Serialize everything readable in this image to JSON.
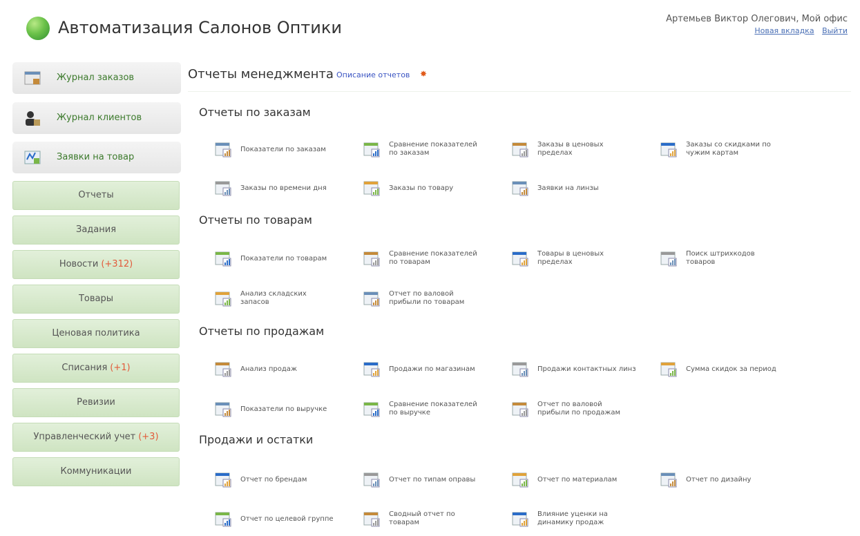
{
  "header": {
    "app_title": "Автоматизация Салонов Оптики",
    "user_name": "Артемьев Виктор Олегович, Мой офис",
    "new_tab": "Новая вкладка",
    "logout": "Выйти"
  },
  "sidebar": {
    "top_items": [
      {
        "label": "Журнал заказов",
        "icon": "journal-icon"
      },
      {
        "label": "Журнал клиентов",
        "icon": "clients-icon"
      },
      {
        "label": "Заявки на товар",
        "icon": "requests-icon"
      }
    ],
    "items": [
      {
        "label": "Отчеты",
        "count": ""
      },
      {
        "label": "Задания",
        "count": ""
      },
      {
        "label": "Новости",
        "count": "(+312)"
      },
      {
        "label": "Товары",
        "count": ""
      },
      {
        "label": "Ценовая политика",
        "count": ""
      },
      {
        "label": "Списания",
        "count": "(+1)"
      },
      {
        "label": "Ревизии",
        "count": ""
      },
      {
        "label": "Управленческий учет",
        "count": "(+3)"
      },
      {
        "label": "Коммуникации",
        "count": ""
      }
    ]
  },
  "main": {
    "title": "Отчеты менеджмента",
    "description_link": "Описание отчетов",
    "sections": [
      {
        "title": "Отчеты по заказам",
        "reports": [
          {
            "line1": "Показатели по заказам",
            "line2": ""
          },
          {
            "line1": "Сравнение показателей",
            "line2": "по заказам"
          },
          {
            "line1": "Заказы в ценовых",
            "line2": "пределах"
          },
          {
            "line1": "Заказы со скидками по",
            "line2": "чужим картам"
          },
          {
            "line1": "Заказы по времени дня",
            "line2": ""
          },
          {
            "line1": "Заказы по товару",
            "line2": ""
          },
          {
            "line1": "Заявки на линзы",
            "line2": ""
          }
        ]
      },
      {
        "title": "Отчеты по товарам",
        "reports": [
          {
            "line1": "Показатели по товарам",
            "line2": ""
          },
          {
            "line1": "Сравнение показателей",
            "line2": "по товарам"
          },
          {
            "line1": "Товары в ценовых",
            "line2": "пределах"
          },
          {
            "line1": "Поиск штрихкодов",
            "line2": "товаров"
          },
          {
            "line1": "Анализ складских",
            "line2": "запасов"
          },
          {
            "line1": "Отчет по валовой",
            "line2": "прибыли по товарам"
          }
        ]
      },
      {
        "title": "Отчеты по продажам",
        "reports": [
          {
            "line1": "Анализ продаж",
            "line2": ""
          },
          {
            "line1": "Продажи по магазинам",
            "line2": ""
          },
          {
            "line1": "Продажи контактных линз",
            "line2": ""
          },
          {
            "line1": "Сумма скидок за период",
            "line2": ""
          },
          {
            "line1": "Показатели по выручке",
            "line2": ""
          },
          {
            "line1": "Сравнение показателей",
            "line2": "по выручке"
          },
          {
            "line1": "Отчет по валовой",
            "line2": "прибыли по продажам"
          }
        ]
      },
      {
        "title": "Продажи и остатки",
        "reports": [
          {
            "line1": "Отчет по брендам",
            "line2": ""
          },
          {
            "line1": "Отчет по типам оправы",
            "line2": ""
          },
          {
            "line1": "Отчет по материалам",
            "line2": ""
          },
          {
            "line1": "Отчет по дизайну",
            "line2": ""
          },
          {
            "line1": "Отчет по целевой группе",
            "line2": ""
          },
          {
            "line1": "Сводный отчет по",
            "line2": "товарам"
          },
          {
            "line1": "Влияние уценки на",
            "line2": "динамику продаж"
          }
        ]
      }
    ]
  },
  "colors": {
    "accent_green": "#3c7a2c",
    "sidebar_green": "#d8ebce",
    "count_red": "#e25a3a",
    "link_blue": "#3a54c2"
  }
}
